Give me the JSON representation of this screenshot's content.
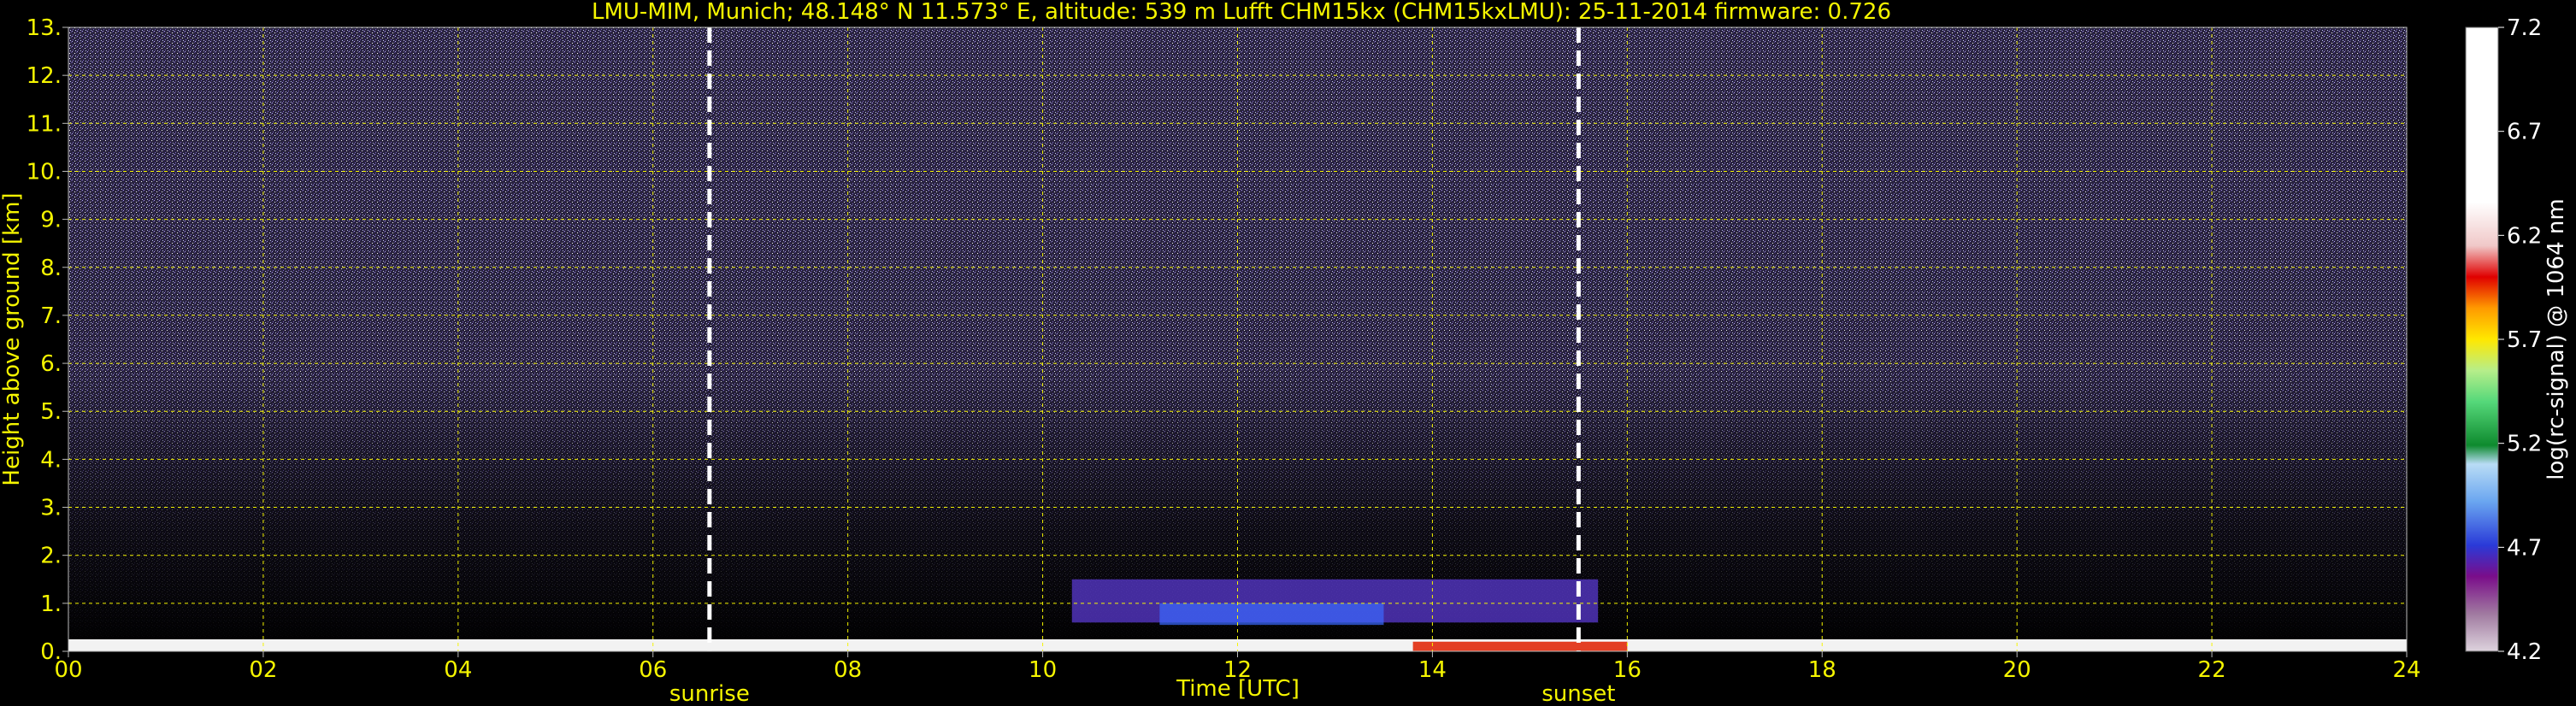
{
  "chart_data": {
    "type": "heatmap",
    "title": "LMU-MIM, Munich; 48.148° N 11.573° E, altitude: 539 m     Lufft CHM15kx (CHM15kxLMU): 25-11-2014     firmware: 0.726",
    "xlabel": "Time [UTC]",
    "ylabel": "Height above ground [km]",
    "xlim": [
      0,
      24
    ],
    "ylim": [
      0,
      13
    ],
    "x_ticks": [
      "00",
      "02",
      "04",
      "06",
      "08",
      "10",
      "12",
      "14",
      "16",
      "18",
      "20",
      "22",
      "24"
    ],
    "y_ticks": [
      "0.",
      "1.",
      "2.",
      "3.",
      "4.",
      "5.",
      "6.",
      "7.",
      "8.",
      "9.",
      "10.",
      "11.",
      "12.",
      "13."
    ],
    "grid": true,
    "grid_color": "#f5f500",
    "colorbar": {
      "label": "log(rc-signal) @ 1064 nm",
      "min": 4.2,
      "max": 7.2,
      "ticks": [
        "4.2",
        "4.7",
        "5.2",
        "5.7",
        "6.2",
        "6.7",
        "7.2"
      ]
    },
    "annotations": [
      {
        "label": "sunrise",
        "x": 6.58
      },
      {
        "label": "sunset",
        "x": 15.5
      }
    ],
    "features": [
      {
        "kind": "surface layer",
        "x": [
          0,
          24
        ],
        "y": [
          0,
          0.25
        ]
      },
      {
        "kind": "residual/aerosol layer",
        "x": [
          10.3,
          15.7
        ],
        "y": [
          0.6,
          1.5
        ]
      },
      {
        "kind": "noise above",
        "x": [
          0,
          24
        ],
        "y": [
          2,
          13
        ]
      }
    ]
  }
}
